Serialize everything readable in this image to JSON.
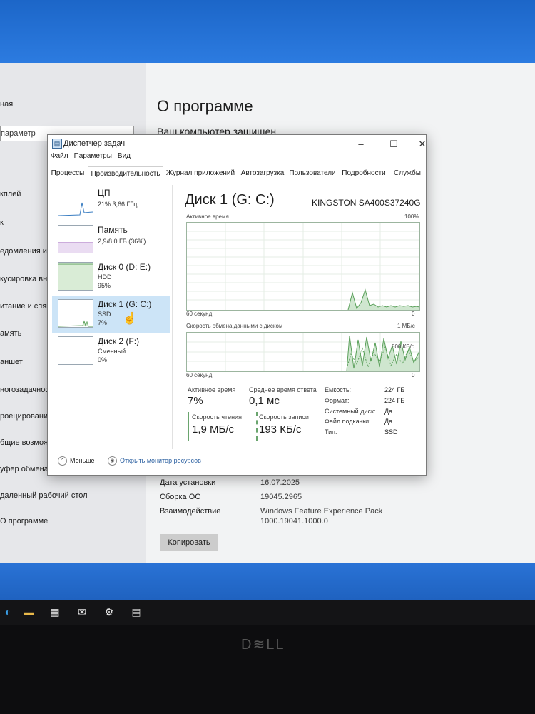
{
  "settings": {
    "left_items": [
      "ная",
      "кплей",
      "к",
      "едомления и д",
      "кусировка вн",
      "итание и спящ",
      "амять",
      "аншет",
      "ногозадачност",
      "роецирование",
      "бщие возможн",
      "уфер обмена",
      "даленный рабочий стол",
      "О программе"
    ],
    "search_placeholder": "параметр",
    "about_title": "О программе",
    "protected_text": "Ваш компьютер защищен",
    "install_date_label": "Дата установки",
    "install_date_value": "16.07.2025",
    "os_build_label": "Сборка ОС",
    "os_build_value": "19045.2965",
    "experience_label": "Взаимодействие",
    "experience_value_1": "Windows Feature Experience Pack",
    "experience_value_2": "1000.19041.1000.0",
    "copy_button": "Копировать"
  },
  "task_manager": {
    "title": "Диспетчер задач",
    "menu": [
      "Файл",
      "Параметры",
      "Вид"
    ],
    "tabs": [
      "Процессы",
      "Производительность",
      "Журнал приложений",
      "Автозагрузка",
      "Пользователи",
      "Подробности",
      "Службы"
    ],
    "active_tab": "Производительность",
    "sidebar": [
      {
        "name": "ЦП",
        "line1": "21% 3,66 ГГц",
        "line2": ""
      },
      {
        "name": "Память",
        "line1": "2,9/8,0 ГБ (36%)",
        "line2": ""
      },
      {
        "name": "Диск 0 (D: E:)",
        "line1": "HDD",
        "line2": "95%"
      },
      {
        "name": "Диск 1 (G: C:)",
        "line1": "SSD",
        "line2": "7%"
      },
      {
        "name": "Диск 2 (F:)",
        "line1": "Сменный",
        "line2": "0%"
      }
    ],
    "selected_index": 3,
    "disk_title": "Диск 1 (G: C:)",
    "disk_model": "KINGSTON SA400S37240G",
    "graph1": {
      "label": "Активное время",
      "max": "100%",
      "time": "60 секунд",
      "min": "0"
    },
    "graph2": {
      "label": "Скорость обмена данными с диском",
      "max": "1 МБ/с",
      "mid": "800 КБ/с",
      "time": "60 секунд",
      "min": "0"
    },
    "stats": {
      "active_label": "Активное время",
      "active_value": "7%",
      "response_label": "Среднее время ответа",
      "response_value": "0,1 мс",
      "read_label": "Скорость чтения",
      "read_value": "1,9 МБ/с",
      "write_label": "Скорость записи",
      "write_value": "193 КБ/с"
    },
    "props": [
      {
        "label": "Емкость:",
        "value": "224 ГБ"
      },
      {
        "label": "Формат:",
        "value": "224 ГБ"
      },
      {
        "label": "Системный диск:",
        "value": "Да"
      },
      {
        "label": "Файл подкачки:",
        "value": "Да"
      },
      {
        "label": "Тип:",
        "value": "SSD"
      }
    ],
    "footer_less": "Меньше",
    "footer_monitor": "Открыть монитор ресурсов"
  },
  "icons": [
    "app-icon",
    "minimize-icon",
    "maximize-icon",
    "close-icon",
    "chevron-up-icon",
    "monitor-icon",
    "search-icon",
    "cursor-hand-icon",
    "edge-icon",
    "explorer-icon",
    "store-icon",
    "mail-icon",
    "settings-icon",
    "taskmgr-icon"
  ],
  "colors": {
    "accent": "#1c66c8",
    "graph_green": "#6aa56e",
    "selection": "#cce4f7"
  }
}
